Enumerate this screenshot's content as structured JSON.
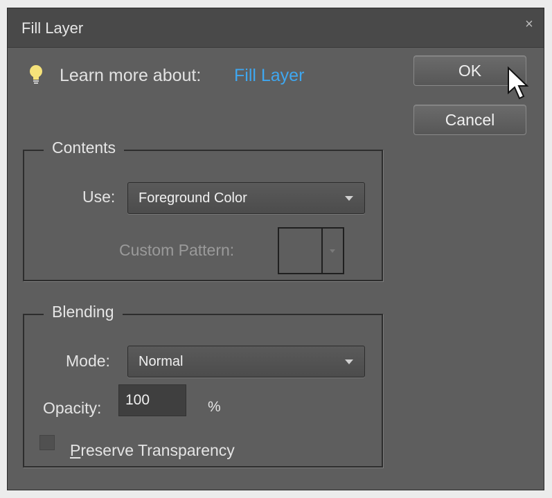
{
  "dialog": {
    "title": "Fill Layer",
    "close_glyph": "×"
  },
  "help": {
    "icon": "lightbulb-icon",
    "prefix": "Learn more about:",
    "link": "Fill Layer"
  },
  "buttons": {
    "ok": "OK",
    "cancel": "Cancel"
  },
  "contents": {
    "legend": "Contents",
    "use_label": "Use:",
    "use_value": "Foreground Color",
    "pattern_label": "Custom Pattern:"
  },
  "blending": {
    "legend": "Blending",
    "mode_label": "Mode:",
    "mode_value": "Normal",
    "opacity_label": "Opacity:",
    "opacity_value": "100",
    "opacity_unit": "%",
    "preserve_label_first": "P",
    "preserve_label_rest": "reserve Transparency",
    "preserve_checked": false
  },
  "colors": {
    "dialog_bg": "#5e5e5e",
    "titlebar_bg": "#494949",
    "link": "#3fa7f0",
    "bulb": "#f5e27a"
  }
}
